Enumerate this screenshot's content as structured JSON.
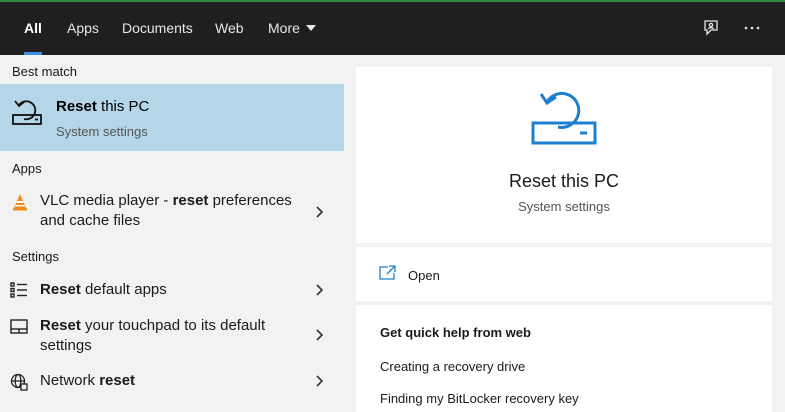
{
  "tabs": [
    {
      "label": "All",
      "active": true
    },
    {
      "label": "Apps"
    },
    {
      "label": "Documents"
    },
    {
      "label": "Web"
    },
    {
      "label": "More"
    }
  ],
  "left": {
    "best_match_heading": "Best match",
    "best_match": {
      "title_bold": "Reset",
      "title_rest": " this PC",
      "subtitle": "System settings",
      "icon": "reset-pc-icon"
    },
    "apps_heading": "Apps",
    "apps": [
      {
        "pre": "VLC media player - ",
        "bold": "reset",
        "post": " preferences",
        "line2": "and cache files",
        "icon": "vlc-icon"
      }
    ],
    "settings_heading": "Settings",
    "settings": [
      {
        "bold": "Reset",
        "post": " default apps",
        "icon": "default-apps-icon"
      },
      {
        "bold": "Reset",
        "post": " your touchpad to its default",
        "line2": "settings",
        "icon": "touchpad-icon"
      },
      {
        "pre": "Network ",
        "bold": "reset",
        "icon": "network-globe-icon"
      }
    ]
  },
  "detail": {
    "title": "Reset this PC",
    "subtitle": "System settings",
    "open_label": "Open",
    "quick_help_heading": "Get quick help from web",
    "links": [
      "Creating a recovery drive",
      "Finding my BitLocker recovery key"
    ]
  },
  "colors": {
    "accent": "#3b8de0",
    "selected_bg": "#b4d6e8",
    "topbar_bg": "#1f1f1f",
    "icon_blue": "#1e7fd1"
  }
}
